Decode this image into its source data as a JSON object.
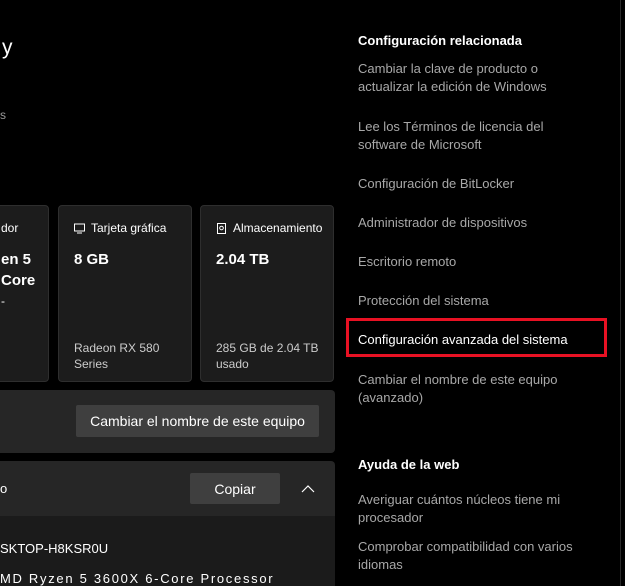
{
  "left": {
    "title_fragment": "y",
    "subtitle_fragment": "s",
    "cards": [
      {
        "header": "dor",
        "value": [
          "en 5",
          "Core",
          "-"
        ],
        "sub": ""
      },
      {
        "header": "Tarjeta gráfica",
        "icon": "monitor-icon",
        "value": [
          "8 GB"
        ],
        "sub": [
          "Radeon RX 580",
          "Series"
        ]
      },
      {
        "header": "Almacenamiento",
        "icon": "drive-icon",
        "value": [
          "2.04 TB"
        ],
        "sub": [
          "285 GB de 2.04 TB",
          "usado"
        ]
      }
    ],
    "rename_button": "Cambiar el nombre de este equipo",
    "spec_section": {
      "label": "o",
      "copy_button": "Copiar",
      "lines": [
        "SKTOP-H8KSR0U",
        "MD Ryzen 5 3600X 6-Core Processor"
      ]
    }
  },
  "related": {
    "heading": "Configuración relacionada",
    "links": [
      {
        "label": [
          "Cambiar la clave de producto o",
          "actualizar la edición de Windows"
        ]
      },
      {
        "label": [
          "Lee los Términos de licencia del",
          "software de Microsoft"
        ]
      },
      {
        "label": [
          "Configuración de BitLocker"
        ]
      },
      {
        "label": [
          "Administrador de dispositivos"
        ]
      },
      {
        "label": [
          "Escritorio remoto"
        ]
      },
      {
        "label": [
          "Protección del sistema"
        ]
      },
      {
        "label": [
          "Configuración avanzada del sistema"
        ],
        "highlighted": true
      },
      {
        "label": [
          "Cambiar el nombre de este equipo",
          "(avanzado)"
        ]
      }
    ]
  },
  "web_help": {
    "heading": "Ayuda de la web",
    "links": [
      {
        "label": [
          "Averiguar cuántos núcleos tiene mi",
          "procesador"
        ]
      },
      {
        "label": [
          "Comprobar compatibilidad con varios",
          "idiomas"
        ]
      }
    ]
  },
  "colors": {
    "background": "#000000",
    "card": "#1c1c1c",
    "link": "#a8a8a8",
    "highlight_border": "#e81123"
  }
}
